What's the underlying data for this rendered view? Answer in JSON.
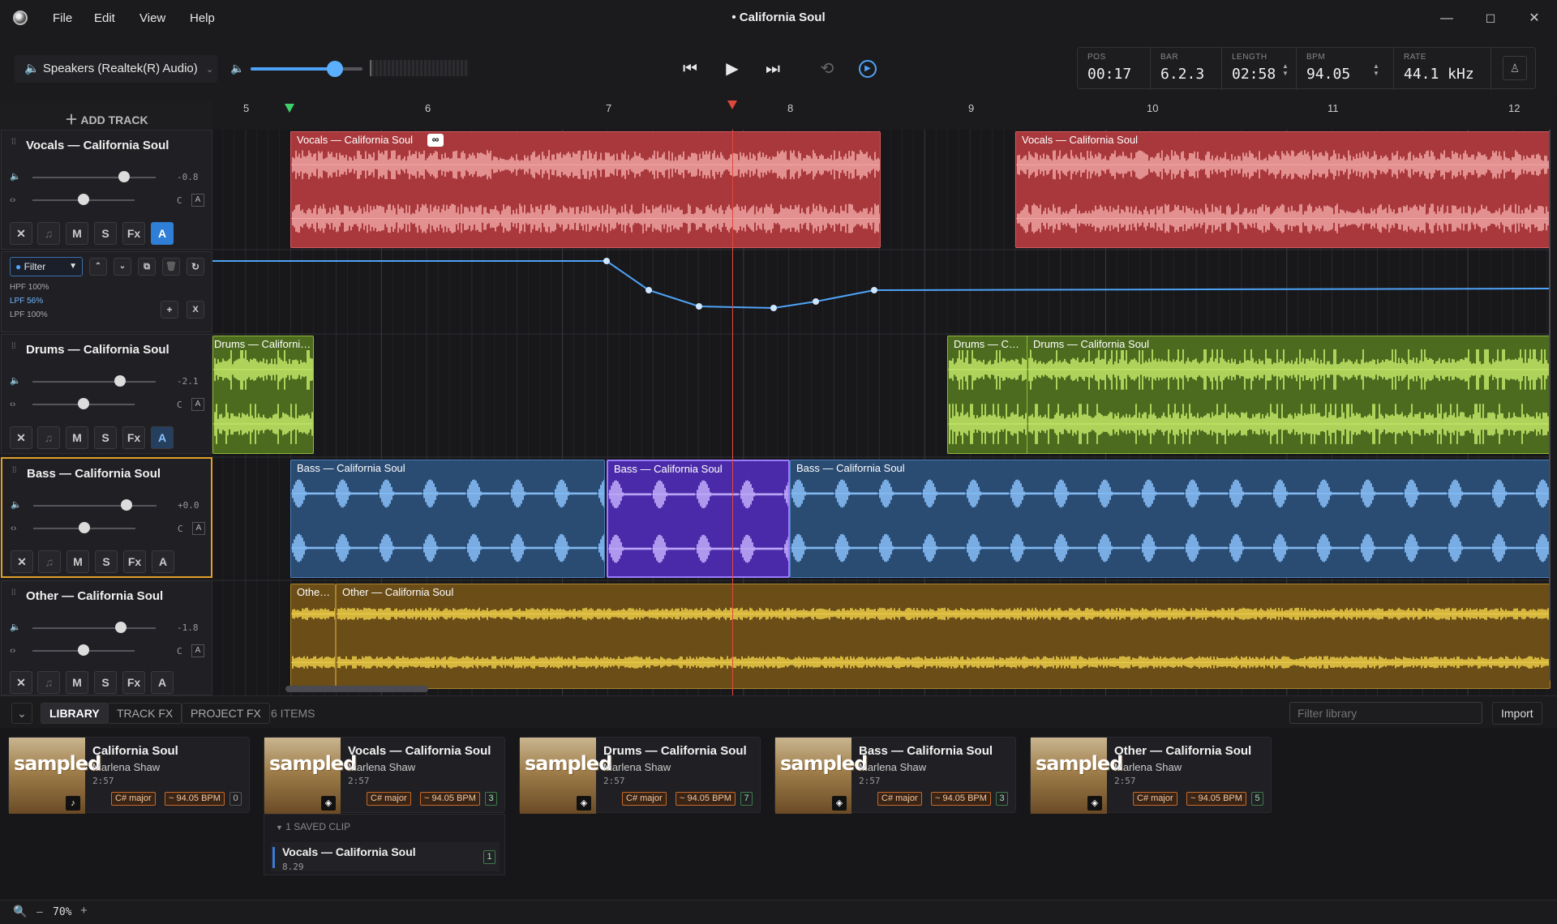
{
  "app": {
    "title": "• California Soul"
  },
  "menu": {
    "file": "File",
    "edit": "Edit",
    "view": "View",
    "help": "Help"
  },
  "transport": {
    "output_device": "Speakers (Realtek(R) Audio)",
    "volume_level": 0.75,
    "readouts": [
      {
        "label": "POS",
        "value": "00:17"
      },
      {
        "label": "BAR",
        "value": "6.2.3"
      },
      {
        "label": "LENGTH",
        "value": "02:58"
      },
      {
        "label": "BPM",
        "value": "94.05"
      },
      {
        "label": "RATE",
        "value": "44.1 kHz"
      }
    ]
  },
  "tracks_panel": {
    "add_track": "ADD TRACK"
  },
  "tracks": [
    {
      "name": "Vocals — California Soul",
      "db": "-0.8",
      "pan": "C",
      "auto": "A",
      "buttons": [
        "M",
        "S",
        "Fx",
        "A"
      ],
      "color": "#a8383c",
      "wave": "#f2a6a6"
    },
    {
      "name": "Drums — California Soul",
      "db": "-2.1",
      "pan": "C",
      "auto": "A",
      "buttons": [
        "M",
        "S",
        "Fx",
        "A"
      ],
      "color": "#4d6b1f",
      "wave": "#c6ec6a"
    },
    {
      "name": "Bass — California Soul",
      "db": "+0.0",
      "pan": "C",
      "auto": "A",
      "buttons": [
        "M",
        "S",
        "Fx",
        "A"
      ],
      "color": "#2a4b72",
      "wave": "#8cc4ff"
    },
    {
      "name": "Other — California Soul",
      "db": "-1.8",
      "pan": "C",
      "auto": "A",
      "buttons": [
        "M",
        "S",
        "Fx",
        "A"
      ],
      "color": "#6b4d18",
      "wave": "#f0d048"
    }
  ],
  "automation": {
    "param": "Filter",
    "lines": [
      "HPF 100%",
      "LPF 56%",
      "LPF 100%"
    ],
    "add": "+",
    "remove": "X"
  },
  "ruler": {
    "bars": [
      "5",
      "6",
      "7",
      "8",
      "9",
      "10",
      "11",
      "12"
    ]
  },
  "clips": {
    "vocals": [
      "Vocals — California Soul",
      "Vocals — California Soul"
    ],
    "drums": [
      "Drums — Californi…",
      "Drums — C…",
      "Drums — California Soul"
    ],
    "bass": [
      "Bass — California Soul",
      "Bass — California Soul",
      "Bass — California Soul"
    ],
    "other": [
      "Othe…",
      "Other — California Soul"
    ]
  },
  "library_bar": {
    "tabs": [
      "LIBRARY",
      "TRACK FX",
      "PROJECT FX"
    ],
    "count": "6 ITEMS",
    "filter_placeholder": "Filter library",
    "import": "Import"
  },
  "library": [
    {
      "title": "California Soul",
      "artist": "Marlena Shaw",
      "duration": "2:57",
      "key": "C# major",
      "bpm": "~ 94.05 BPM",
      "count": "0",
      "icon": "music-note-icon"
    },
    {
      "title": "Vocals — California Soul",
      "artist": "Marlena Shaw",
      "duration": "2:57",
      "key": "C# major",
      "bpm": "~ 94.05 BPM",
      "count": "3",
      "icon": "layers-icon"
    },
    {
      "title": "Drums — California Soul",
      "artist": "Marlena Shaw",
      "duration": "2:57",
      "key": "C# major",
      "bpm": "~ 94.05 BPM",
      "count": "7",
      "icon": "layers-icon"
    },
    {
      "title": "Bass — California Soul",
      "artist": "Marlena Shaw",
      "duration": "2:57",
      "key": "C# major",
      "bpm": "~ 94.05 BPM",
      "count": "3",
      "icon": "layers-icon"
    },
    {
      "title": "Other — California Soul",
      "artist": "Marlena Shaw",
      "duration": "2:57",
      "key": "C# major",
      "bpm": "~ 94.05 BPM",
      "count": "5",
      "icon": "layers-icon"
    }
  ],
  "saved_clips": {
    "header": "1 SAVED CLIP",
    "name": "Vocals — California Soul",
    "time": "8.29",
    "count": "1"
  },
  "status": {
    "zoom": "70%",
    "cover_logo": "sampled"
  }
}
